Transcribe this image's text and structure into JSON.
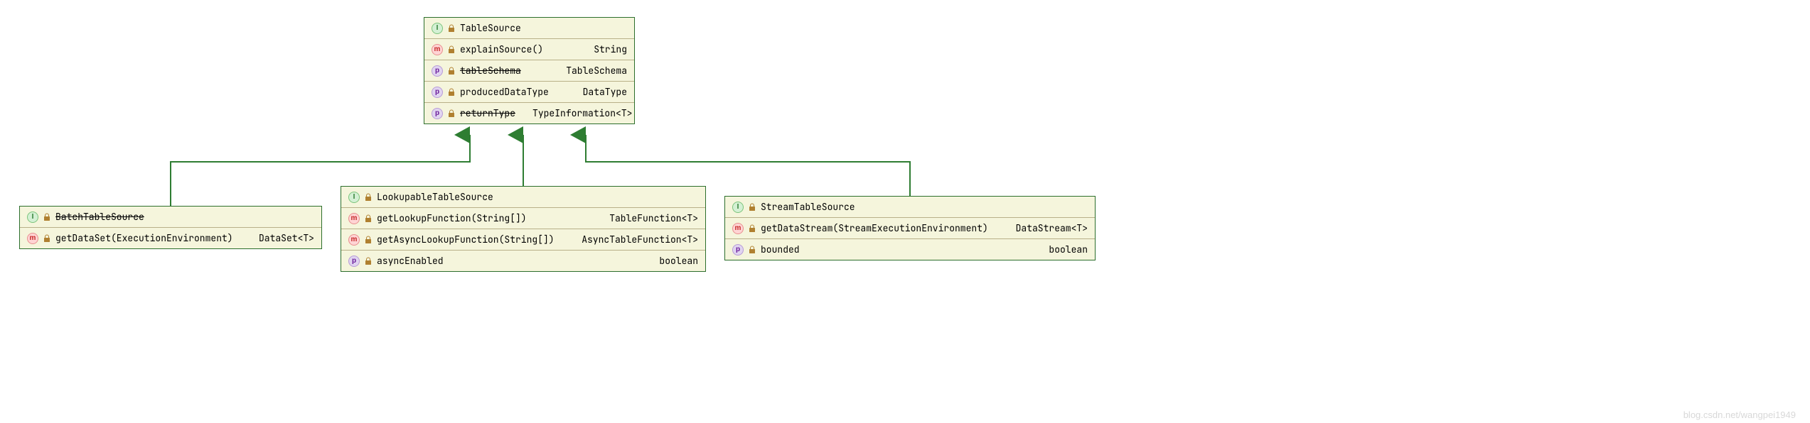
{
  "classes": {
    "tableSource": {
      "kind": "I",
      "name": "TableSource",
      "strike": false,
      "rows": [
        {
          "kind": "m",
          "name": "explainSource()",
          "type": "String",
          "strike": false
        },
        {
          "kind": "p",
          "name": "tableSchema",
          "type": "TableSchema",
          "strike": true
        },
        {
          "kind": "p",
          "name": "producedDataType",
          "type": "DataType",
          "strike": false
        },
        {
          "kind": "p",
          "name": "returnType",
          "type": "TypeInformation<T>",
          "strike": true
        }
      ]
    },
    "batchTableSource": {
      "kind": "I",
      "name": "BatchTableSource",
      "strike": true,
      "rows": [
        {
          "kind": "m",
          "name": "getDataSet(ExecutionEnvironment)",
          "type": "DataSet<T>",
          "strike": false
        }
      ]
    },
    "lookupableTableSource": {
      "kind": "I",
      "name": "LookupableTableSource",
      "strike": false,
      "rows": [
        {
          "kind": "m",
          "name": "getLookupFunction(String[])",
          "type": "TableFunction<T>",
          "strike": false
        },
        {
          "kind": "m",
          "name": "getAsyncLookupFunction(String[])",
          "type": "AsyncTableFunction<T>",
          "strike": false
        },
        {
          "kind": "p",
          "name": "asyncEnabled",
          "type": "boolean",
          "strike": false
        }
      ]
    },
    "streamTableSource": {
      "kind": "I",
      "name": "StreamTableSource",
      "strike": false,
      "rows": [
        {
          "kind": "m",
          "name": "getDataStream(StreamExecutionEnvironment)",
          "type": "DataStream<T>",
          "strike": false
        },
        {
          "kind": "p",
          "name": "bounded",
          "type": "boolean",
          "strike": false
        }
      ]
    }
  },
  "colors": {
    "border": "#2c6e2c",
    "bg": "#f5f5dc",
    "line": "#2e7d32"
  },
  "watermark": "blog.csdn.net/wangpei1949"
}
